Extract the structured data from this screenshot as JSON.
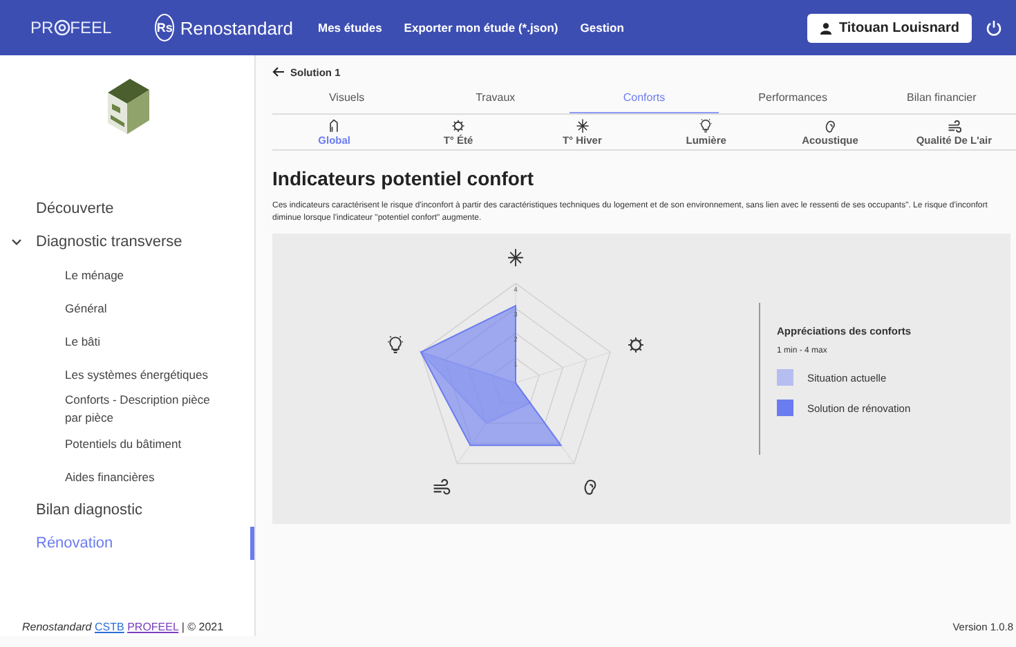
{
  "header": {
    "brand_left": "PR",
    "brand_right": "FEEL",
    "brand2_mark": "Rs",
    "brand2": "Renostandard",
    "nav": [
      "Mes études",
      "Exporter mon étude (*.json)",
      "Gestion"
    ],
    "user": "Titouan Louisnard"
  },
  "sidebar": {
    "items": [
      {
        "label": "Découverte",
        "selected": false
      },
      {
        "label": "Diagnostic transverse",
        "selected": false,
        "expanded": true,
        "children": [
          {
            "label": "Le ménage",
            "selected": false
          },
          {
            "label": "Général",
            "selected": false
          },
          {
            "label": "Le bâti",
            "selected": false
          },
          {
            "label": "Les systèmes énergétiques",
            "selected": false
          },
          {
            "label": "Conforts - Description pièce par pièce",
            "selected": false
          },
          {
            "label": "Potentiels du bâtiment",
            "selected": false
          },
          {
            "label": "Aides financières",
            "selected": false
          }
        ]
      },
      {
        "label": "Bilan diagnostic",
        "selected": false
      },
      {
        "label": "Rénovation",
        "selected": true
      }
    ]
  },
  "back": "Solution 1",
  "tabs": [
    {
      "label": "Visuels",
      "selected": false
    },
    {
      "label": "Travaux",
      "selected": false
    },
    {
      "label": "Conforts",
      "selected": true
    },
    {
      "label": "Performances",
      "selected": false
    },
    {
      "label": "Bilan financier",
      "selected": false
    }
  ],
  "subtabs": [
    {
      "label": "Global",
      "selected": true
    },
    {
      "label": "T° Été",
      "selected": false
    },
    {
      "label": "T° Hiver",
      "selected": false
    },
    {
      "label": "Lumière",
      "selected": false
    },
    {
      "label": "Acoustique",
      "selected": false
    },
    {
      "label": "Qualité De L'air",
      "selected": false
    }
  ],
  "title": "Indicateurs potentiel confort",
  "description": "Ces indicateurs caractérisent le risque d'inconfort à partir des caractéristiques techniques du logement et de son environnement, sans lien avec le ressenti de ses occupants\". Le risque d'inconfort diminue lorsque l'indicateur \"potentiel confort\" augmente.",
  "legend": {
    "title": "Appréciations des conforts",
    "range": "1 min - 4 max"
  },
  "radar": {
    "ticks": [
      "4",
      "3",
      "2",
      "1"
    ],
    "series": [
      {
        "name": "Situation actuelle",
        "color": "#b6bdf0"
      },
      {
        "name": "Solution de rénovation",
        "color": "#6b7bf0"
      }
    ]
  },
  "footer": {
    "brand": "Renostandard",
    "link1": "CSTB",
    "link2": "PROFEEL",
    "copyright": "| © 2021",
    "version": "Version 1.0.8"
  }
}
